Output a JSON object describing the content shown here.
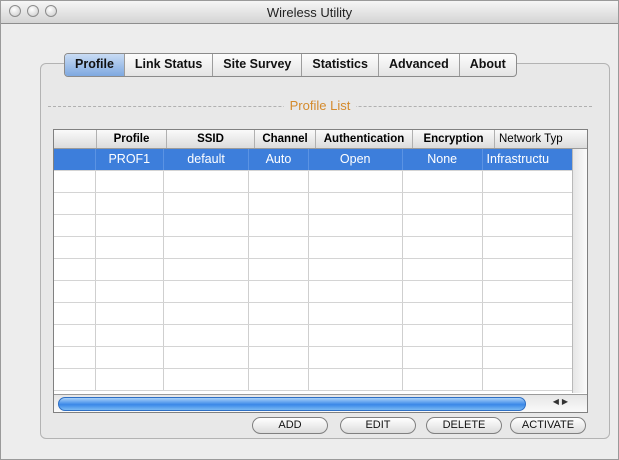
{
  "window": {
    "title": "Wireless Utility"
  },
  "tabs": [
    "Profile",
    "Link Status",
    "Site Survey",
    "Statistics",
    "Advanced",
    "About"
  ],
  "section": {
    "label": "Profile List"
  },
  "table": {
    "headers": [
      "",
      "Profile",
      "SSID",
      "Channel",
      "Authentication",
      "Encryption",
      "Network Typ"
    ],
    "rows": [
      [
        "",
        "PROF1",
        "default",
        "Auto",
        "Open",
        "None",
        "Infrastructu"
      ],
      [
        "",
        "",
        "",
        "",
        "",
        "",
        ""
      ],
      [
        "",
        "",
        "",
        "",
        "",
        "",
        ""
      ],
      [
        "",
        "",
        "",
        "",
        "",
        "",
        ""
      ],
      [
        "",
        "",
        "",
        "",
        "",
        "",
        ""
      ],
      [
        "",
        "",
        "",
        "",
        "",
        "",
        ""
      ],
      [
        "",
        "",
        "",
        "",
        "",
        "",
        ""
      ],
      [
        "",
        "",
        "",
        "",
        "",
        "",
        ""
      ],
      [
        "",
        "",
        "",
        "",
        "",
        "",
        ""
      ],
      [
        "",
        "",
        "",
        "",
        "",
        "",
        ""
      ],
      [
        "",
        "",
        "",
        "",
        "",
        "",
        ""
      ]
    ],
    "selected_row": 0
  },
  "buttons": {
    "add": "ADD",
    "edit": "EDIT",
    "delete": "DELETE",
    "activate": "ACTIVATE"
  },
  "colors": {
    "selection": "#3d7edb",
    "section_label": "#d48a2c",
    "tab_active": "#7ea8e0"
  }
}
